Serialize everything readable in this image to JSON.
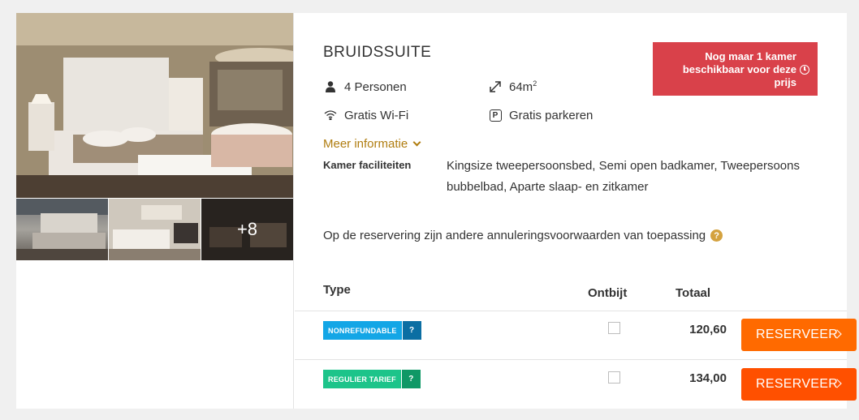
{
  "room": {
    "title": "BRUIDSSUITE",
    "features": {
      "persons": "4 Personen",
      "area": "64m",
      "area_sup": "2",
      "wifi": "Gratis Wi-Fi",
      "parking": "Gratis parkeren",
      "parking_icon_letter": "P"
    },
    "more_info": "Meer informatie",
    "facilities_label": "Kamer faciliteiten",
    "facilities": "Kingsize tweepersoonsbed, Semi open badkamer, Tweepersoons bubbelbad, Aparte slaap- en zitkamer",
    "cancellation_note": "Op de reservering zijn andere annuleringsvoorwaarden van toepassing",
    "cancellation_help": "?"
  },
  "alert": {
    "text": "Nog maar 1 kamer beschikbaar voor deze prijs",
    "color": "#d9414a"
  },
  "gallery": {
    "more_count": "+8"
  },
  "table": {
    "headers": {
      "type": "Type",
      "ontbijt": "Ontbijt",
      "totaal": "Totaal"
    },
    "rows": [
      {
        "rate": "NONREFUNDABLE",
        "help": "?",
        "breakfast": false,
        "total": "120,60",
        "button": "RESERVEER",
        "color": "#13a6e6"
      },
      {
        "rate": "REGULIER TARIEF",
        "help": "?",
        "breakfast": false,
        "total": "134,00",
        "button": "RESERVEER",
        "color": "#1dc48a"
      }
    ]
  },
  "colors": {
    "accent": "#ff5a00",
    "link": "#b07d10"
  }
}
